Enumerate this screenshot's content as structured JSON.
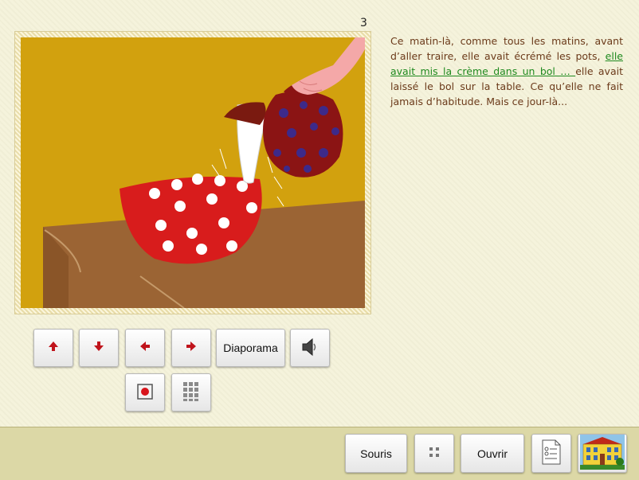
{
  "page": {
    "number": "3"
  },
  "story": {
    "text_before": "Ce matin-là, comme tous les matins, avant d’aller traire, elle avait écrémé les pots, ",
    "highlight": "elle avait mis la crème dans un bol … ",
    "text_after": "elle avait laissé le bol sur la table. Ce qu’elle ne fait jamais d’habitude. Mais ce jour-là..."
  },
  "nav": {
    "up": "up-arrow-icon",
    "down": "down-arrow-icon",
    "left": "left-arrow-icon",
    "right": "right-arrow-icon",
    "slideshow_label": "Diaporama",
    "sound": "speaker-icon",
    "record": "record-icon",
    "grid": "grid-icon"
  },
  "bottom": {
    "mouse_label": "Souris",
    "dots": "four-dots-icon",
    "open_label": "Ouvrir",
    "doc": "document-icon",
    "school": "school-building-icon"
  },
  "colors": {
    "text": "#6b3a1a",
    "highlight": "#1f8a1f",
    "arrow": "#c0141c"
  }
}
